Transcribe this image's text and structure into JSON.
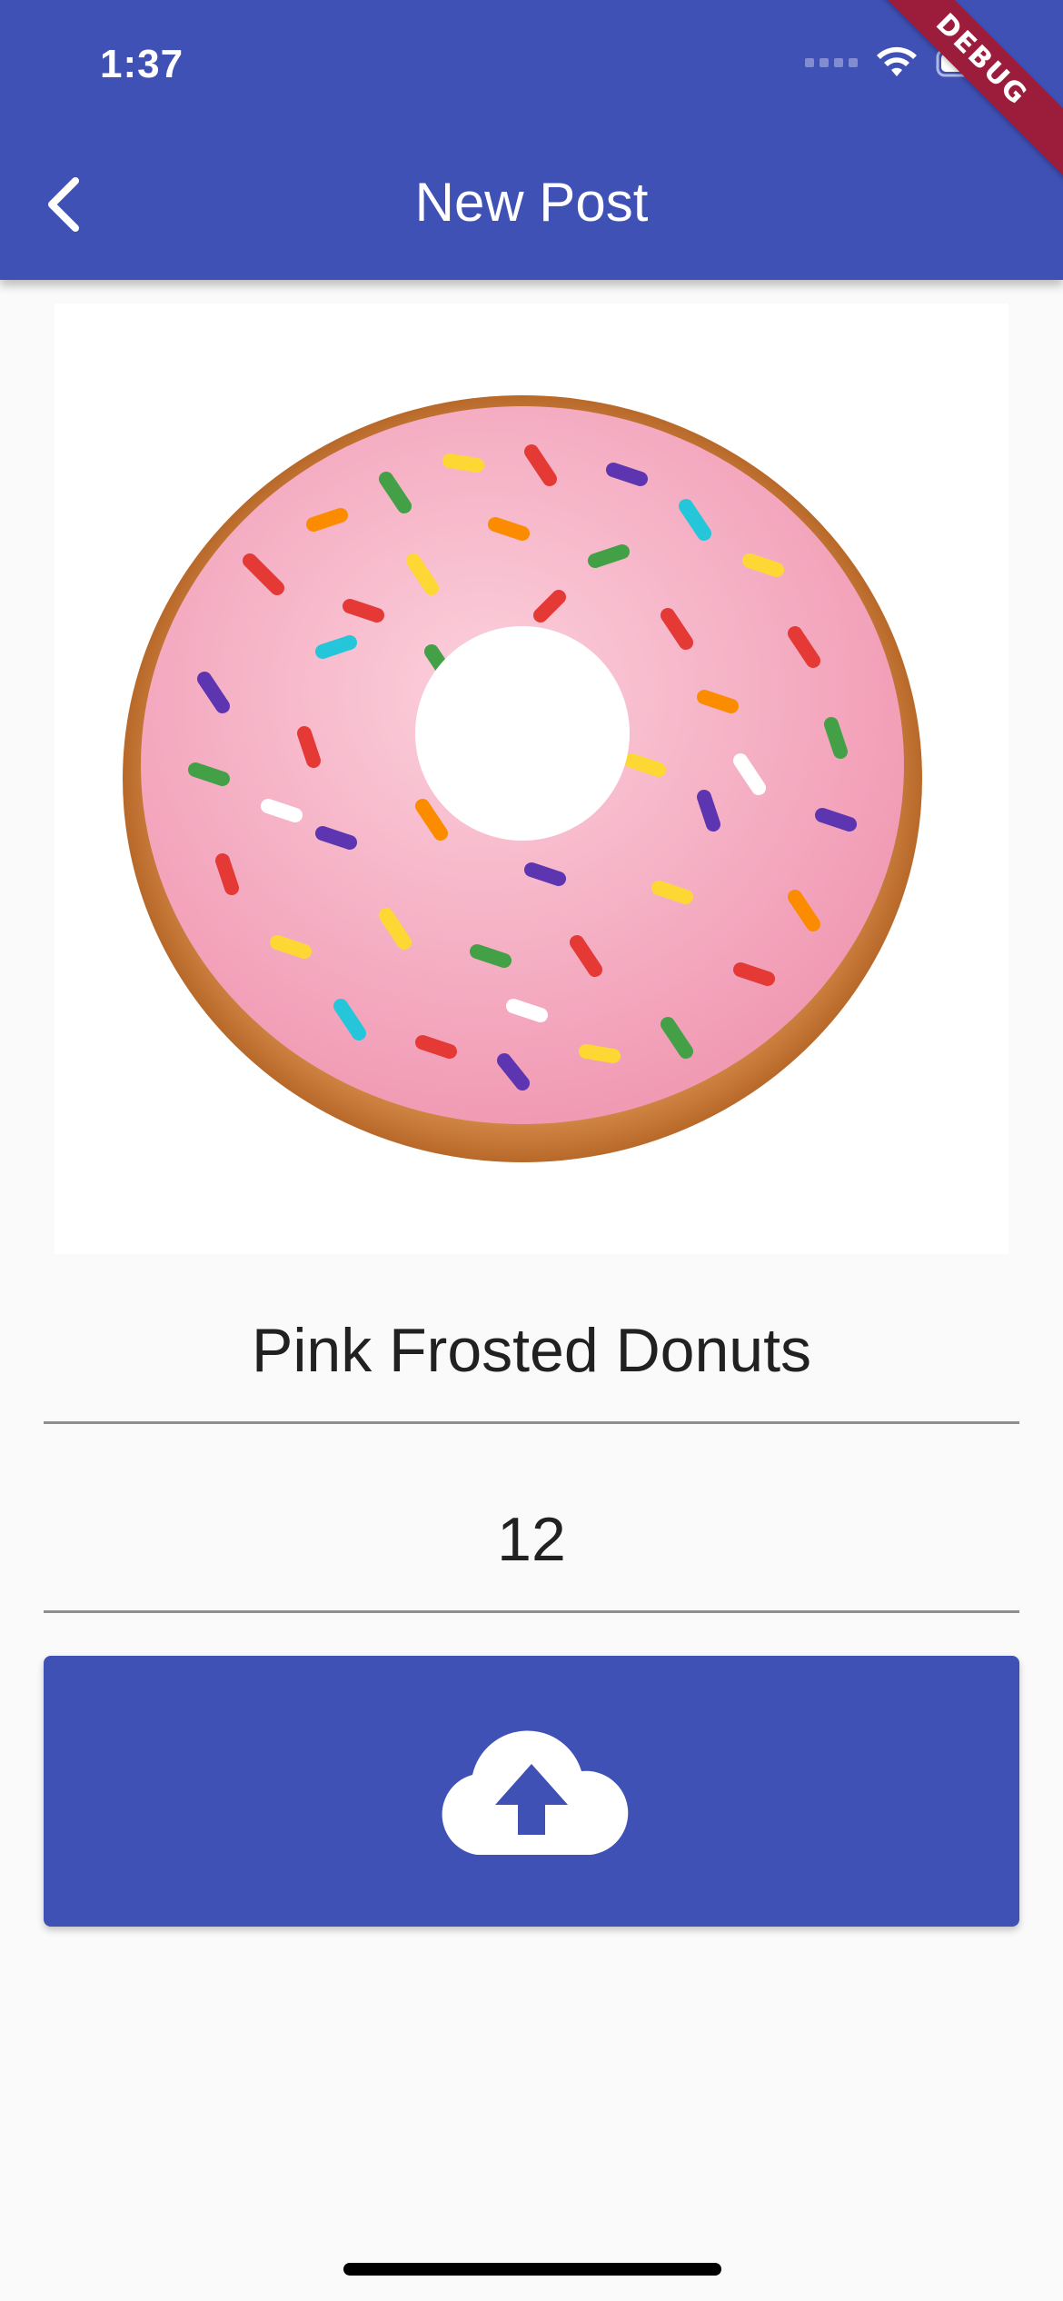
{
  "status_bar": {
    "time": "1:37",
    "icons": [
      "signal-icon",
      "wifi-icon",
      "battery-icon"
    ]
  },
  "debug_banner": "DEBUG",
  "app_bar": {
    "back_icon": "chevron-left-icon",
    "title": "New Post"
  },
  "post": {
    "image": "pink-frosted-donut-with-sprinkles",
    "name_value": "Pink Frosted Donuts",
    "quantity_value": "12"
  },
  "upload_button": {
    "icon": "cloud-upload-icon"
  },
  "colors": {
    "primary": "#3f51b5",
    "background": "#fafafa",
    "debug": "#9c1c3b",
    "text": "#212121"
  }
}
